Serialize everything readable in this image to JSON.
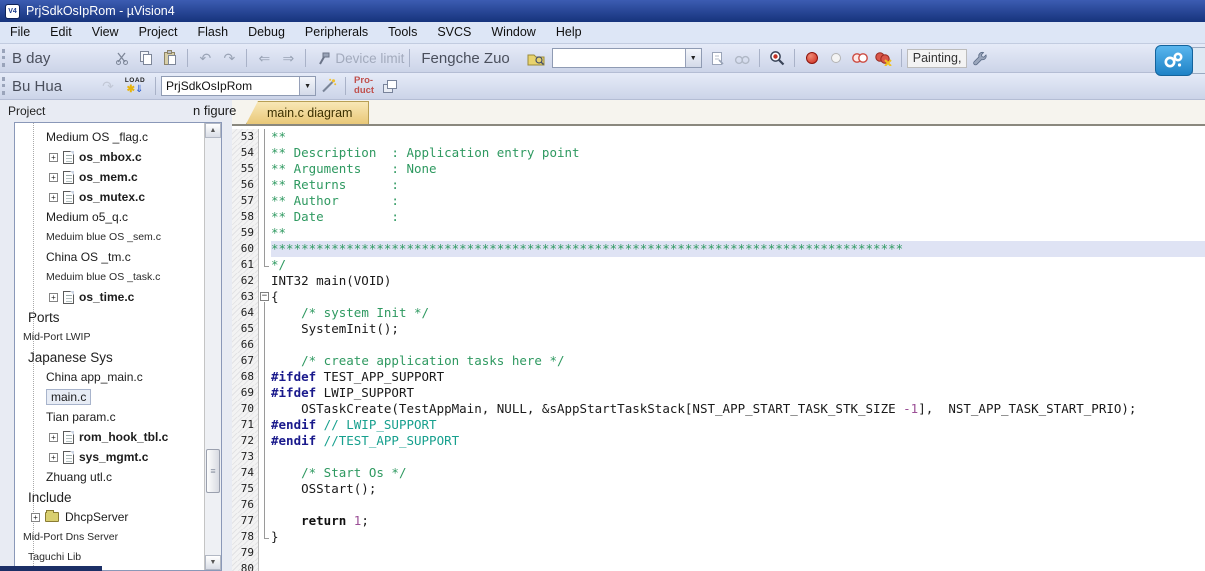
{
  "window": {
    "title": "PrjSdkOsIpRom  - µVision4"
  },
  "menu": {
    "items": [
      "File",
      "Edit",
      "View",
      "Project",
      "Flash",
      "Debug",
      "Peripherals",
      "Tools",
      "SVCS",
      "Window",
      "Help"
    ]
  },
  "toolbar_top": {
    "overlay_label": "B day",
    "device_limit_label": "Device limit",
    "author_label": "Fengche Zuo",
    "search_combo_value": "",
    "painting_label": "Painting,"
  },
  "toolbar_build": {
    "overlay_label": "Bu Hua",
    "load_label": "LOAD",
    "target_combo_value": "PrjSdkOsIpRom",
    "product_line1": "Pro-",
    "product_line2": "duct"
  },
  "project_panel": {
    "title": "Project",
    "overlay_text": "n figure",
    "tree": [
      {
        "label": "Medium OS _flag.c",
        "depth": 2,
        "type": "label",
        "variant": "normal"
      },
      {
        "label": "os_mbox.c",
        "depth": 2,
        "type": "file",
        "variant": "file"
      },
      {
        "label": "os_mem.c",
        "depth": 2,
        "type": "file",
        "variant": "file"
      },
      {
        "label": "os_mutex.c",
        "depth": 2,
        "type": "file",
        "variant": "file"
      },
      {
        "label": "Medium o5_q.c",
        "depth": 2,
        "type": "label",
        "variant": "normal"
      },
      {
        "label": "Meduim blue OS _sem.c",
        "depth": 2,
        "type": "label",
        "variant": "small"
      },
      {
        "label": "China OS _tm.c",
        "depth": 2,
        "type": "label",
        "variant": "normal"
      },
      {
        "label": "Meduim blue OS _task.c",
        "depth": 2,
        "type": "label",
        "variant": "small"
      },
      {
        "label": "os_time.c",
        "depth": 2,
        "type": "file",
        "variant": "file"
      },
      {
        "label": "Ports",
        "depth": 1,
        "type": "label",
        "variant": "large"
      },
      {
        "label": "Mid-Port LWIP",
        "depth": 0,
        "type": "label",
        "variant": "small"
      },
      {
        "label": "Japanese Sys",
        "depth": 1,
        "type": "label",
        "variant": "large"
      },
      {
        "label": "China app_main.c",
        "depth": 2,
        "type": "label",
        "variant": "normal"
      },
      {
        "label": "main.c",
        "depth": 2,
        "type": "label",
        "variant": "normal",
        "selected": true
      },
      {
        "label": "Tian param.c",
        "depth": 2,
        "type": "label",
        "variant": "normal"
      },
      {
        "label": "rom_hook_tbl.c",
        "depth": 2,
        "type": "file",
        "variant": "file"
      },
      {
        "label": "sys_mgmt.c",
        "depth": 2,
        "type": "file",
        "variant": "file"
      },
      {
        "label": "Zhuang utl.c",
        "depth": 2,
        "type": "label",
        "variant": "normal"
      },
      {
        "label": "Include",
        "depth": 1,
        "type": "label",
        "variant": "large"
      },
      {
        "label": "DhcpServer",
        "depth": 1,
        "type": "folder",
        "variant": "normal"
      },
      {
        "label": "Mid-Port Dns Server",
        "depth": 0,
        "type": "label",
        "variant": "small"
      },
      {
        "label": "Taguchi Lib",
        "depth": 1,
        "type": "label",
        "variant": "small"
      }
    ]
  },
  "editor": {
    "tab_label": "main.c diagram",
    "colors": {
      "comment": "#2e9960",
      "comment_teal": "#17a08e",
      "preproc": "#1a1a8c",
      "number": "#9b4f96",
      "plain": "#1a1a1a",
      "line_highlight": "#dfe3f4"
    },
    "lines": [
      {
        "n": 53,
        "f": "line",
        "s": [
          {
            "c": "cm",
            "t": "**"
          }
        ]
      },
      {
        "n": 54,
        "f": "line",
        "s": [
          {
            "c": "cm",
            "t": "** Description  : Application entry point"
          }
        ]
      },
      {
        "n": 55,
        "f": "line",
        "s": [
          {
            "c": "cm",
            "t": "** Arguments    : None"
          }
        ]
      },
      {
        "n": 56,
        "f": "line",
        "s": [
          {
            "c": "cm",
            "t": "** Returns      :"
          }
        ]
      },
      {
        "n": 57,
        "f": "line",
        "s": [
          {
            "c": "cm",
            "t": "** Author       :"
          }
        ]
      },
      {
        "n": 58,
        "f": "line",
        "s": [
          {
            "c": "cm",
            "t": "** Date         :"
          }
        ]
      },
      {
        "n": 59,
        "f": "line",
        "s": [
          {
            "c": "cm",
            "t": "**"
          }
        ]
      },
      {
        "n": 60,
        "f": "line",
        "h": true,
        "s": [
          {
            "c": "cm",
            "t": "************************************************************************************"
          }
        ]
      },
      {
        "n": 61,
        "f": "end",
        "s": [
          {
            "c": "cm",
            "t": "*/"
          }
        ]
      },
      {
        "n": 62,
        "s": [
          {
            "c": "pl",
            "t": "INT32 main(VOID)"
          }
        ]
      },
      {
        "n": 63,
        "f": "start",
        "s": [
          {
            "c": "pl",
            "t": "{"
          }
        ]
      },
      {
        "n": 64,
        "f": "line",
        "s": [
          {
            "c": "pl",
            "t": "    "
          },
          {
            "c": "cm",
            "t": "/* system Init */"
          }
        ]
      },
      {
        "n": 65,
        "f": "line",
        "s": [
          {
            "c": "pl",
            "t": "    SystemInit();"
          }
        ]
      },
      {
        "n": 66,
        "f": "line",
        "s": []
      },
      {
        "n": 67,
        "f": "line",
        "s": [
          {
            "c": "pl",
            "t": "    "
          },
          {
            "c": "cm",
            "t": "/* create application tasks here */"
          }
        ]
      },
      {
        "n": 68,
        "f": "line",
        "s": [
          {
            "c": "pp",
            "t": "#ifdef"
          },
          {
            "c": "pl",
            "t": " TEST_APP_SUPPORT"
          }
        ]
      },
      {
        "n": 69,
        "f": "line",
        "s": [
          {
            "c": "pp",
            "t": "#ifdef"
          },
          {
            "c": "pl",
            "t": " LWIP_SUPPORT"
          }
        ]
      },
      {
        "n": 70,
        "f": "line",
        "s": [
          {
            "c": "pl",
            "t": "    OSTaskCreate(TestAppMain, NULL, &sAppStartTaskStack[NST_APP_START_TASK_STK_SIZE "
          },
          {
            "c": "num",
            "t": "-1"
          },
          {
            "c": "pl",
            "t": "],  NST_APP_TASK_START_PRIO);"
          }
        ]
      },
      {
        "n": 71,
        "f": "line",
        "s": [
          {
            "c": "pp",
            "t": "#endif"
          },
          {
            "c": "cm2",
            "t": " // LWIP_SUPPORT"
          }
        ]
      },
      {
        "n": 72,
        "f": "line",
        "s": [
          {
            "c": "pp",
            "t": "#endif"
          },
          {
            "c": "cm2",
            "t": " //TEST_APP_SUPPORT"
          }
        ]
      },
      {
        "n": 73,
        "f": "line",
        "s": []
      },
      {
        "n": 74,
        "f": "line",
        "s": [
          {
            "c": "pl",
            "t": "    "
          },
          {
            "c": "cm",
            "t": "/* Start Os */"
          }
        ]
      },
      {
        "n": 75,
        "f": "line",
        "s": [
          {
            "c": "pl",
            "t": "    OSStart();"
          }
        ]
      },
      {
        "n": 76,
        "f": "line",
        "s": []
      },
      {
        "n": 77,
        "f": "line",
        "s": [
          {
            "c": "pl",
            "t": "    "
          },
          {
            "c": "kw",
            "t": "return"
          },
          {
            "c": "pl",
            "t": " "
          },
          {
            "c": "num",
            "t": "1"
          },
          {
            "c": "pl",
            "t": ";"
          }
        ]
      },
      {
        "n": 78,
        "f": "end",
        "s": [
          {
            "c": "pl",
            "t": "}"
          }
        ]
      },
      {
        "n": 79,
        "s": []
      },
      {
        "n": 80,
        "s": []
      }
    ]
  }
}
